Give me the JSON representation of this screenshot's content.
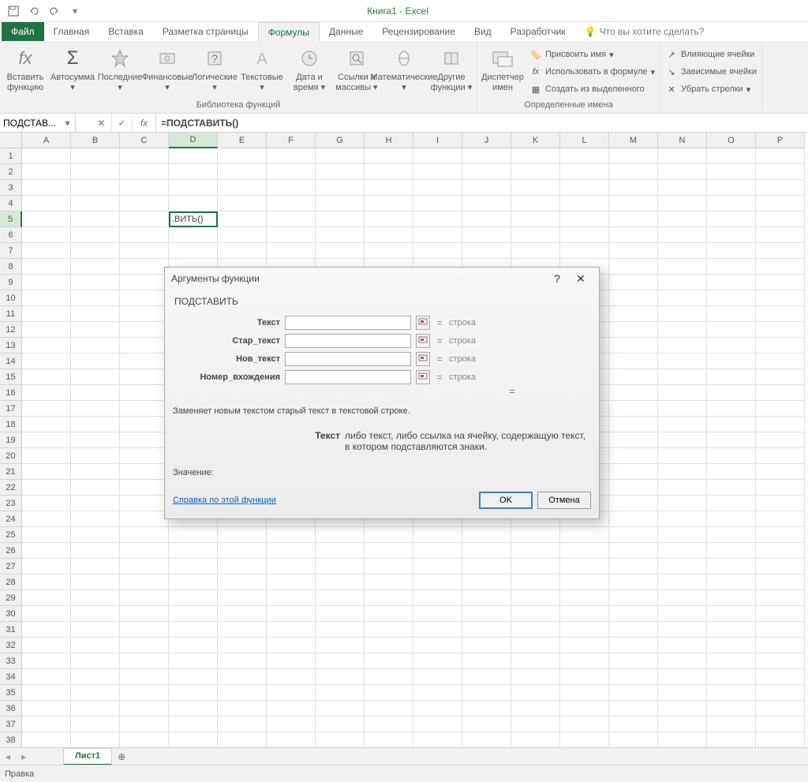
{
  "app_title": "Книга1 - Excel",
  "tabs": {
    "file": "Файл",
    "home": "Главная",
    "insert": "Вставка",
    "layout": "Разметка страницы",
    "formulas": "Формулы",
    "data": "Данные",
    "review": "Рецензирование",
    "view": "Вид",
    "developer": "Разработчик",
    "tell_me": "Что вы хотите сделать?"
  },
  "ribbon": {
    "insert_fn": "Вставить функцию",
    "autosum": "Автосумма",
    "recent": "Последние",
    "financial": "Финансовые",
    "logical": "Логические",
    "text": "Текстовые",
    "datetime": "Дата и время",
    "lookup": "Ссылки и массивы",
    "math": "Математические",
    "more": "Другие функции",
    "group_lib": "Библиотека функций",
    "name_mgr": "Диспетчер имен",
    "def_name": "Присвоить имя",
    "use_in_formula": "Использовать в формуле",
    "create_from_sel": "Создать из выделенного",
    "group_names": "Определенные имена",
    "trace_prec": "Влияющие ячейки",
    "trace_dep": "Зависимые ячейки",
    "remove_arrows": "Убрать стрелки"
  },
  "name_box": "ПОДСТАВ...",
  "formula": "=ПОДСТАВИТЬ()",
  "columns": [
    "A",
    "B",
    "C",
    "D",
    "E",
    "F",
    "G",
    "H",
    "I",
    "J",
    "K",
    "L",
    "M",
    "N",
    "O",
    "P"
  ],
  "active_cell_display": ".ВИТЬ()",
  "active_row": 5,
  "active_col": "D",
  "sheet_tab": "Лист1",
  "status": "Правка",
  "dialog": {
    "title": "Аргументы функции",
    "fn": "ПОДСТАВИТЬ",
    "args": [
      {
        "label": "Текст",
        "val": "строка"
      },
      {
        "label": "Стар_текст",
        "val": "строка"
      },
      {
        "label": "Нов_текст",
        "val": "строка"
      },
      {
        "label": "Номер_вхождения",
        "val": "строка"
      }
    ],
    "desc": "Заменяет новым текстом старый текст в текстовой строке.",
    "arg_name": "Текст",
    "arg_desc": "либо текст, либо ссылка на ячейку, содержащую текст, в котором подставляются знаки.",
    "result_label": "Значение:",
    "help": "Справка по этой функции",
    "ok": "OK",
    "cancel": "Отмена"
  }
}
